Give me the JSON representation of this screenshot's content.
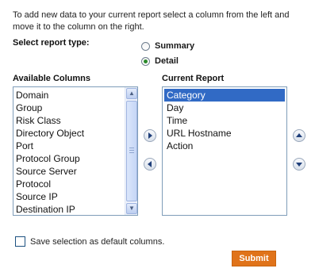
{
  "intro_text": "To add new data to your current report select a column from the left and move it to the column on the right.",
  "report_type": {
    "label": "Select report type:",
    "options": [
      {
        "label": "Summary",
        "selected": false
      },
      {
        "label": "Detail",
        "selected": true
      }
    ]
  },
  "available_columns": {
    "heading": "Available Columns",
    "items": [
      "Domain",
      "Group",
      "Risk Class",
      "Directory Object",
      "Port",
      "Protocol Group",
      "Source Server",
      "Protocol",
      "Source IP",
      "Destination IP"
    ]
  },
  "current_report": {
    "heading": "Current Report",
    "items": [
      "Category",
      "Day",
      "Time",
      "URL Hostname",
      "Action"
    ],
    "selected_item": "Category"
  },
  "save_default": {
    "label": "Save selection as default columns.",
    "checked": false
  },
  "submit_label": "Submit",
  "colors": {
    "accent": "#e0731a",
    "selection": "#316ac5",
    "radio_checked": "#2b8a2b"
  },
  "icons": {
    "move_right": "arrow-right-icon",
    "move_left": "arrow-left-icon",
    "move_up": "arrow-up-icon",
    "move_down": "arrow-down-icon"
  }
}
